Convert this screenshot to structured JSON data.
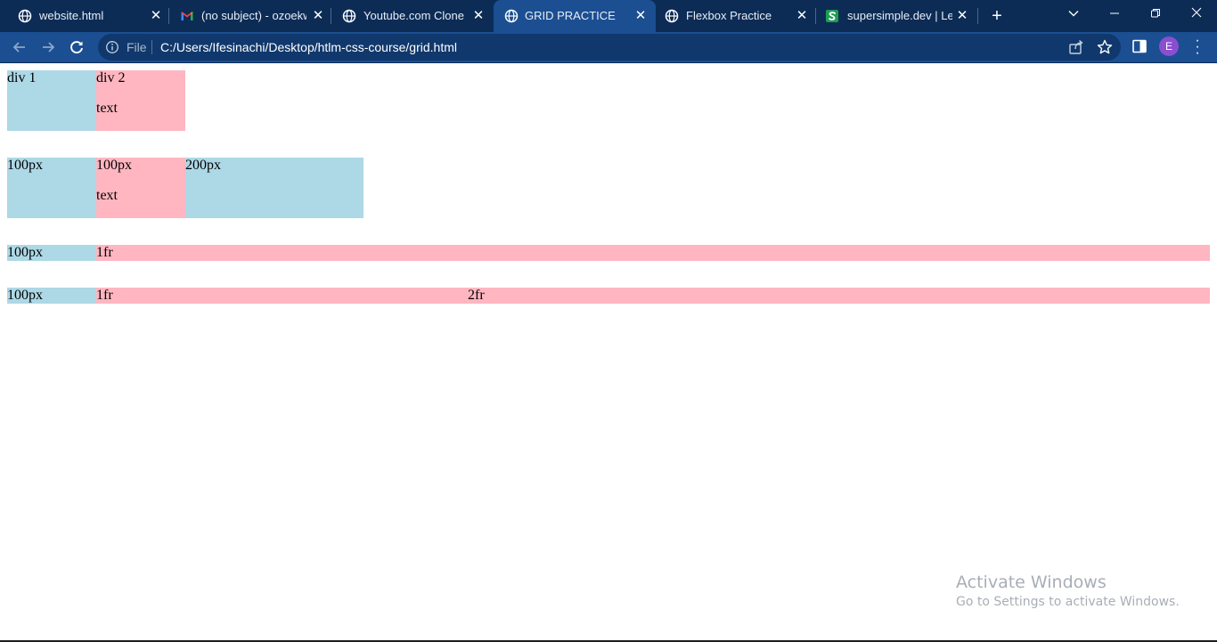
{
  "browser": {
    "tabs": [
      {
        "title": "website.html",
        "favicon": "globe-icon",
        "active": false
      },
      {
        "title": "(no subject) - ozoekwe",
        "favicon": "gmail-icon",
        "active": false
      },
      {
        "title": "Youtube.com Clone",
        "favicon": "globe-icon",
        "active": false
      },
      {
        "title": "GRID PRACTICE",
        "favicon": "globe-icon",
        "active": true
      },
      {
        "title": "Flexbox Practice",
        "favicon": "globe-icon",
        "active": false
      },
      {
        "title": "supersimple.dev | Learn",
        "favicon": "supersimple-icon",
        "active": false
      }
    ],
    "address": {
      "scheme_label": "File",
      "url": "C:/Users/Ifesinachi/Desktop/htlm-css-course/grid.html"
    },
    "profile_initial": "E",
    "colors": {
      "tab_strip": "#0c2c56",
      "toolbar": "#1b4f92",
      "omnibox": "#10386c"
    }
  },
  "page": {
    "grid1": {
      "cells": [
        {
          "lines": [
            "div 1"
          ]
        },
        {
          "lines": [
            "div 2",
            "text"
          ]
        }
      ]
    },
    "grid2": {
      "cells": [
        {
          "lines": [
            "100px"
          ]
        },
        {
          "lines": [
            "100px",
            "text"
          ]
        },
        {
          "lines": [
            "200px"
          ]
        }
      ]
    },
    "grid3": {
      "cells": [
        {
          "lines": [
            "100px"
          ]
        },
        {
          "lines": [
            "1fr"
          ]
        }
      ]
    },
    "grid4": {
      "cells": [
        {
          "lines": [
            "100px"
          ]
        },
        {
          "lines": [
            "1fr"
          ]
        },
        {
          "lines": [
            "2fr"
          ]
        }
      ]
    },
    "colors": {
      "blue": "#add8e6",
      "pink": "#ffb6c1"
    }
  },
  "watermark": {
    "title": "Activate Windows",
    "subtitle": "Go to Settings to activate Windows."
  }
}
